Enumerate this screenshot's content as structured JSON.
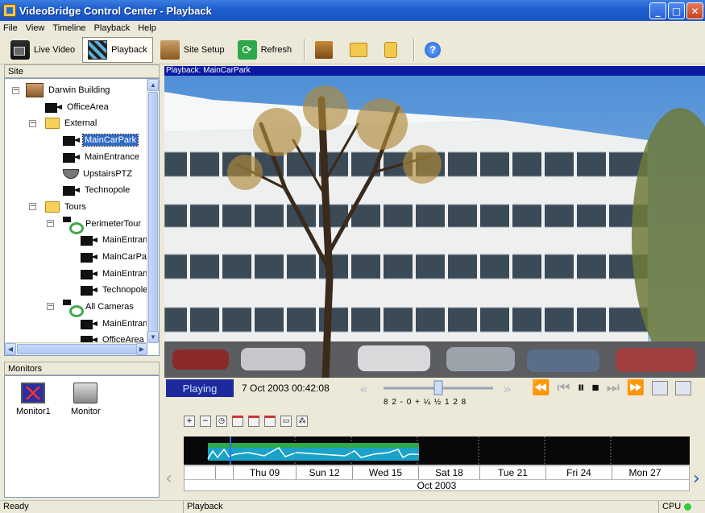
{
  "window": {
    "title": "VideoBridge Control Center - Playback",
    "min": "_",
    "max": "□",
    "close": "✕"
  },
  "menu": [
    "File",
    "View",
    "Timeline",
    "Playback",
    "Help"
  ],
  "toolbar": {
    "live_video": "Live Video",
    "playback": "Playback",
    "site_setup": "Site Setup",
    "refresh": "Refresh",
    "help": "?"
  },
  "site": {
    "header": "Site",
    "tree": [
      {
        "label": "Darwin Building",
        "icon": "building-icon"
      },
      {
        "label": "OfficeArea",
        "icon": "camera-icon"
      },
      {
        "label": "External",
        "icon": "folder-icon"
      },
      {
        "label": "MainCarPark",
        "icon": "camera-icon",
        "selected": true
      },
      {
        "label": "MainEntrance",
        "icon": "camera-icon"
      },
      {
        "label": "UpstairsPTZ",
        "icon": "ptz-camera-icon"
      },
      {
        "label": "Technopole",
        "icon": "camera-icon"
      },
      {
        "label": "Tours",
        "icon": "folder-icon"
      },
      {
        "label": "PerimeterTour",
        "icon": "tour-icon"
      },
      {
        "label": "MainEntrance",
        "icon": "camera-icon"
      },
      {
        "label": "MainCarPark",
        "icon": "camera-icon"
      },
      {
        "label": "MainEntrance",
        "icon": "camera-icon"
      },
      {
        "label": "Technopole",
        "icon": "camera-icon"
      },
      {
        "label": "All Cameras",
        "icon": "tour-icon"
      },
      {
        "label": "MainEntrance",
        "icon": "camera-icon"
      },
      {
        "label": "OfficeArea",
        "icon": "camera-icon"
      }
    ]
  },
  "monitors": {
    "header": "Monitors",
    "items": [
      {
        "label": "Monitor1",
        "icon": "monitor-icon"
      },
      {
        "label": "Monitor",
        "icon": "video-monitor-icon"
      }
    ]
  },
  "video": {
    "header": "Playback: MainCarPark"
  },
  "playback": {
    "state": "Playing",
    "timestamp": "7 Oct 2003 00:42:08",
    "speed_labels": "8  2  -  0  +  ¼  ½  1  2  8",
    "speed_value": 0.5
  },
  "timeline": {
    "days": [
      "Thu 09",
      "Sun 12",
      "Wed 15",
      "Sat 18",
      "Tue 21",
      "Fri 24",
      "Mon 27"
    ],
    "month": "Oct 2003"
  },
  "statusbar": {
    "left": "Ready",
    "middle": "Playback",
    "right": "CPU"
  },
  "colors": {
    "title_bar": "#1f5fd0",
    "selection": "#316ac5",
    "playing_bg": "#1c2a9e",
    "timeline_activity": "#1aa2c8",
    "cpu_ok": "#2ecc40"
  }
}
